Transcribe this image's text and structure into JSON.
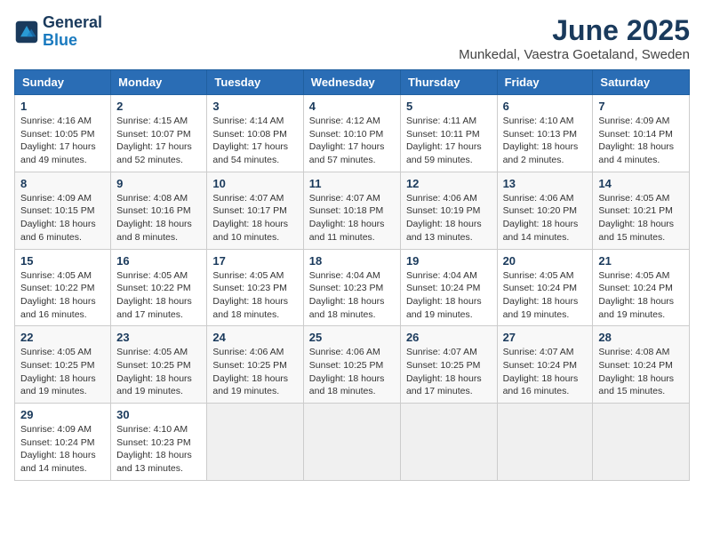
{
  "header": {
    "logo_line1": "General",
    "logo_line2": "Blue",
    "month": "June 2025",
    "location": "Munkedal, Vaestra Goetaland, Sweden"
  },
  "weekdays": [
    "Sunday",
    "Monday",
    "Tuesday",
    "Wednesday",
    "Thursday",
    "Friday",
    "Saturday"
  ],
  "weeks": [
    [
      {
        "day": "1",
        "info": "Sunrise: 4:16 AM\nSunset: 10:05 PM\nDaylight: 17 hours\nand 49 minutes."
      },
      {
        "day": "2",
        "info": "Sunrise: 4:15 AM\nSunset: 10:07 PM\nDaylight: 17 hours\nand 52 minutes."
      },
      {
        "day": "3",
        "info": "Sunrise: 4:14 AM\nSunset: 10:08 PM\nDaylight: 17 hours\nand 54 minutes."
      },
      {
        "day": "4",
        "info": "Sunrise: 4:12 AM\nSunset: 10:10 PM\nDaylight: 17 hours\nand 57 minutes."
      },
      {
        "day": "5",
        "info": "Sunrise: 4:11 AM\nSunset: 10:11 PM\nDaylight: 17 hours\nand 59 minutes."
      },
      {
        "day": "6",
        "info": "Sunrise: 4:10 AM\nSunset: 10:13 PM\nDaylight: 18 hours\nand 2 minutes."
      },
      {
        "day": "7",
        "info": "Sunrise: 4:09 AM\nSunset: 10:14 PM\nDaylight: 18 hours\nand 4 minutes."
      }
    ],
    [
      {
        "day": "8",
        "info": "Sunrise: 4:09 AM\nSunset: 10:15 PM\nDaylight: 18 hours\nand 6 minutes."
      },
      {
        "day": "9",
        "info": "Sunrise: 4:08 AM\nSunset: 10:16 PM\nDaylight: 18 hours\nand 8 minutes."
      },
      {
        "day": "10",
        "info": "Sunrise: 4:07 AM\nSunset: 10:17 PM\nDaylight: 18 hours\nand 10 minutes."
      },
      {
        "day": "11",
        "info": "Sunrise: 4:07 AM\nSunset: 10:18 PM\nDaylight: 18 hours\nand 11 minutes."
      },
      {
        "day": "12",
        "info": "Sunrise: 4:06 AM\nSunset: 10:19 PM\nDaylight: 18 hours\nand 13 minutes."
      },
      {
        "day": "13",
        "info": "Sunrise: 4:06 AM\nSunset: 10:20 PM\nDaylight: 18 hours\nand 14 minutes."
      },
      {
        "day": "14",
        "info": "Sunrise: 4:05 AM\nSunset: 10:21 PM\nDaylight: 18 hours\nand 15 minutes."
      }
    ],
    [
      {
        "day": "15",
        "info": "Sunrise: 4:05 AM\nSunset: 10:22 PM\nDaylight: 18 hours\nand 16 minutes."
      },
      {
        "day": "16",
        "info": "Sunrise: 4:05 AM\nSunset: 10:22 PM\nDaylight: 18 hours\nand 17 minutes."
      },
      {
        "day": "17",
        "info": "Sunrise: 4:05 AM\nSunset: 10:23 PM\nDaylight: 18 hours\nand 18 minutes."
      },
      {
        "day": "18",
        "info": "Sunrise: 4:04 AM\nSunset: 10:23 PM\nDaylight: 18 hours\nand 18 minutes."
      },
      {
        "day": "19",
        "info": "Sunrise: 4:04 AM\nSunset: 10:24 PM\nDaylight: 18 hours\nand 19 minutes."
      },
      {
        "day": "20",
        "info": "Sunrise: 4:05 AM\nSunset: 10:24 PM\nDaylight: 18 hours\nand 19 minutes."
      },
      {
        "day": "21",
        "info": "Sunrise: 4:05 AM\nSunset: 10:24 PM\nDaylight: 18 hours\nand 19 minutes."
      }
    ],
    [
      {
        "day": "22",
        "info": "Sunrise: 4:05 AM\nSunset: 10:25 PM\nDaylight: 18 hours\nand 19 minutes."
      },
      {
        "day": "23",
        "info": "Sunrise: 4:05 AM\nSunset: 10:25 PM\nDaylight: 18 hours\nand 19 minutes."
      },
      {
        "day": "24",
        "info": "Sunrise: 4:06 AM\nSunset: 10:25 PM\nDaylight: 18 hours\nand 19 minutes."
      },
      {
        "day": "25",
        "info": "Sunrise: 4:06 AM\nSunset: 10:25 PM\nDaylight: 18 hours\nand 18 minutes."
      },
      {
        "day": "26",
        "info": "Sunrise: 4:07 AM\nSunset: 10:25 PM\nDaylight: 18 hours\nand 17 minutes."
      },
      {
        "day": "27",
        "info": "Sunrise: 4:07 AM\nSunset: 10:24 PM\nDaylight: 18 hours\nand 16 minutes."
      },
      {
        "day": "28",
        "info": "Sunrise: 4:08 AM\nSunset: 10:24 PM\nDaylight: 18 hours\nand 15 minutes."
      }
    ],
    [
      {
        "day": "29",
        "info": "Sunrise: 4:09 AM\nSunset: 10:24 PM\nDaylight: 18 hours\nand 14 minutes."
      },
      {
        "day": "30",
        "info": "Sunrise: 4:10 AM\nSunset: 10:23 PM\nDaylight: 18 hours\nand 13 minutes."
      },
      {
        "day": "",
        "info": ""
      },
      {
        "day": "",
        "info": ""
      },
      {
        "day": "",
        "info": ""
      },
      {
        "day": "",
        "info": ""
      },
      {
        "day": "",
        "info": ""
      }
    ]
  ]
}
